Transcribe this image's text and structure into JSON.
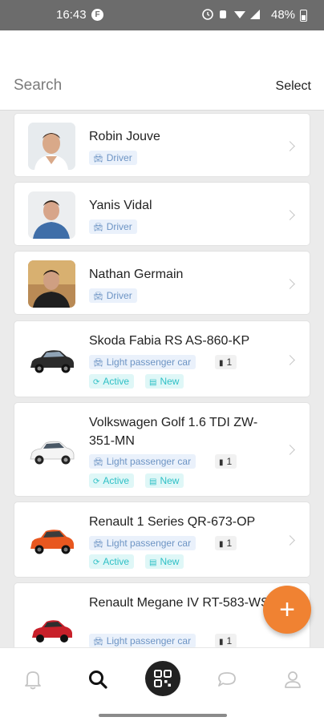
{
  "status_bar": {
    "time": "16:43",
    "battery_text": "48%",
    "notif_icon": "F"
  },
  "header": {
    "search_placeholder": "Search",
    "select_label": "Select"
  },
  "items": [
    {
      "kind": "person",
      "name": "Robin Jouve",
      "role": "Driver",
      "avatar": "avatar-robin"
    },
    {
      "kind": "person",
      "name": "Yanis Vidal",
      "role": "Driver",
      "avatar": "avatar-yanis"
    },
    {
      "kind": "person",
      "name": "Nathan Germain",
      "role": "Driver",
      "avatar": "avatar-nathan"
    },
    {
      "kind": "vehicle",
      "title": "Skoda Fabia RS AS-860-KP",
      "category": "Light passenger car",
      "count": "1",
      "status": "Active",
      "condition": "New",
      "car_color": "#2b2b2b"
    },
    {
      "kind": "vehicle",
      "title": "Volkswagen Golf 1.6 TDI ZW-351-MN",
      "category": "Light passenger car",
      "count": "1",
      "status": "Active",
      "condition": "New",
      "car_color": "#ffffff"
    },
    {
      "kind": "vehicle",
      "title": "Renault 1 Series QR-673-OP",
      "category": "Light passenger car",
      "count": "1",
      "status": "Active",
      "condition": "New",
      "car_color": "#e8571f"
    },
    {
      "kind": "vehicle",
      "title": "Renault Megane IV RT-583-WS",
      "category": "Light passenger car",
      "count": "1",
      "car_color": "#c8202a"
    }
  ],
  "fab": {
    "label": "+"
  },
  "colors": {
    "accent": "#f08232",
    "tag_blue": "#6d94c4",
    "tag_cyan": "#2fc0c6"
  },
  "bottom_nav": [
    {
      "name": "notifications",
      "icon": "bell-icon"
    },
    {
      "name": "search",
      "icon": "search-icon",
      "active": true
    },
    {
      "name": "scan",
      "icon": "qr-code-icon"
    },
    {
      "name": "messages",
      "icon": "chat-icon"
    },
    {
      "name": "profile",
      "icon": "user-icon"
    }
  ]
}
